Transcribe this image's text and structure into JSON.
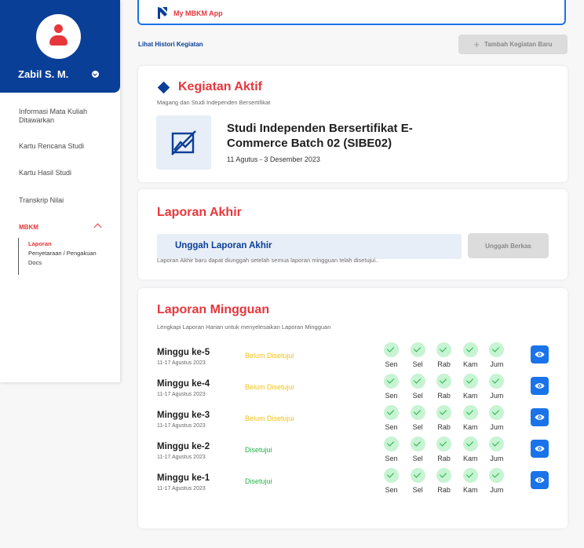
{
  "profile": {
    "name": "Zabil S. M."
  },
  "nav": {
    "items": [
      "Informasi Mata Kuliah Ditawarkan",
      "Kartu Rencana Studi",
      "Kartu Hasil Studi",
      "Transkrip Nilai"
    ],
    "mbkm_label": "MBKM",
    "sub_items": [
      "Laporan",
      "Penyetaraan / Pengakuan",
      "Docs"
    ]
  },
  "topbar": {
    "app_label": "My MBKM App"
  },
  "actions": {
    "histori_link": "Lihat Histori Kegiatan",
    "tambah_button": "Tambah Kegiatan Baru"
  },
  "kegiatan_aktif": {
    "title": "Kegiatan Aktif",
    "subtitle": "Magang dan Studi Independen Bersertifikat",
    "activity_title": "Studi Independen Bersertifikat E-Commerce Batch 02 (SIBE02)",
    "activity_date": "11 Agutus - 3 Desember 2023"
  },
  "laporan_akhir": {
    "title": "Laporan Akhir",
    "upload_label": "Unggah Laporan Akhir",
    "upload_button": "Unggah Berkas",
    "note": "Laporan Akhir baru dapat diunggah setelah semua laporan mingguan telah disetujui.."
  },
  "laporan_mingguan": {
    "title": "Laporan Mingguan",
    "subtitle": "Lengkapi Laporan Harian untuk menyelesaikan Laporan Mingguan",
    "days": [
      "Sen",
      "Sel",
      "Rab",
      "Kam",
      "Jum"
    ],
    "weeks": [
      {
        "name": "Minggu ke-5",
        "date": "11-17 Agustus 2023",
        "status": "Belum Disetujui",
        "status_color": "#f2c318"
      },
      {
        "name": "Minggu ke-4",
        "date": "11-17 Agustus 2023",
        "status": "Belum Disetujui",
        "status_color": "#f2c318"
      },
      {
        "name": "Minggu ke-3",
        "date": "11-17 Agustus 2023",
        "status": "Belum Disetujui",
        "status_color": "#f2c318"
      },
      {
        "name": "Minggu ke-2",
        "date": "11-17 Agustus 2023",
        "status": "Disetujui",
        "status_color": "#24b34b"
      },
      {
        "name": "Minggu ke-1",
        "date": "11-17 Agustus 2023",
        "status": "Disetujui",
        "status_color": "#24b34b"
      }
    ]
  },
  "colors": {
    "brand_blue": "#0a3f97",
    "accent_red": "#e6373c",
    "action_blue": "#1a73e8"
  },
  "icons": {
    "avatar": "user-icon",
    "image_placeholder": "image-off-icon",
    "view": "eye-icon",
    "check": "check-icon"
  }
}
